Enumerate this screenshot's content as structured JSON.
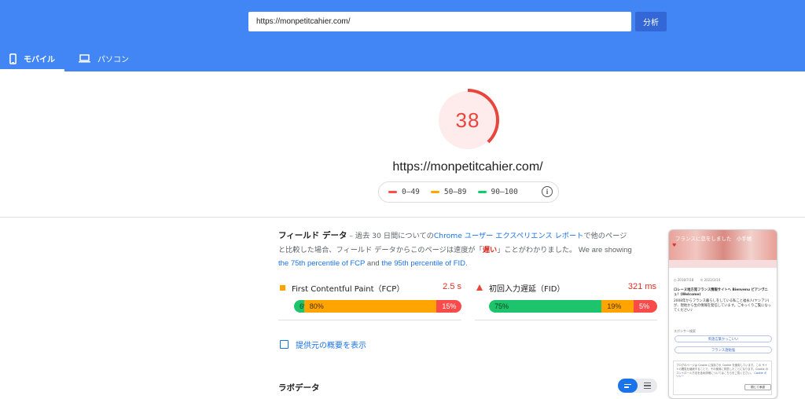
{
  "header": {
    "url_value": "https://monpetitcahier.com/",
    "analyze_label": "分析",
    "tabs": [
      {
        "label": "モバイル",
        "active": true
      },
      {
        "label": "パソコン",
        "active": false
      }
    ]
  },
  "score": {
    "value": "38",
    "fraction": 0.38,
    "color": "#e8453c",
    "url": "https://monpetitcahier.com/"
  },
  "legend": [
    {
      "label": "0–49",
      "color": "#ff4e42"
    },
    {
      "label": "50–89",
      "color": "#ffa400"
    },
    {
      "label": "90–100",
      "color": "#0cce6b"
    }
  ],
  "field_data": {
    "title": "フィールド データ",
    "desc_1": " – 過去 30 日間についての",
    "link_1": "Chrome ユーザー エクスペリエンス レポート",
    "desc_2": "で他のページと比較した場合、フィールド データからこのページは速度が「",
    "slow_word": "遅い",
    "desc_3": "」ことがわかりました。",
    "en_1": " We are showing ",
    "link_2": "the 75th percentile of FCP",
    "en_2": " and ",
    "link_3": "the 95th percentile of FID",
    "en_3": "."
  },
  "metrics": [
    {
      "name": "First Contentful Paint（FCP）",
      "value": "2.5 s",
      "distribution": [
        {
          "label": "6%",
          "fraction": 0.06,
          "kind": "g"
        },
        {
          "label": "80%",
          "fraction": 0.8,
          "kind": "o"
        },
        {
          "label": "15%",
          "fraction": 0.15,
          "kind": "r"
        }
      ]
    },
    {
      "name": "初回入力遅延（FID）",
      "value": "321 ms",
      "distribution": [
        {
          "label": "75%",
          "fraction": 0.67,
          "kind": "g"
        },
        {
          "label": "19%",
          "fraction": 0.19,
          "kind": "o"
        },
        {
          "label": "5%",
          "fraction": 0.14,
          "kind": "r"
        }
      ]
    }
  ],
  "origin_summary_label": "提供元の概要を表示",
  "lab_data_title": "ラボデータ",
  "phone": {
    "banner_title": "フランスに恋をしました　小手帳",
    "date_1": "2018/7/18",
    "date_2": "2022/3/14",
    "headline": "ロレーヌ地方発フランス情報サイトへ Bienvenu ビアンヴニュ！(Welcome)",
    "body": "2008年からフランス暮らしをしている私こと福永人(ヤンアジ)が、現地から生の情報を発信しています。ごゆっくりご覧になってください♪",
    "sponsor": "スポンサー検索",
    "btn_1": "英語言葉かっこいい",
    "btn_2": "フランス語勉強",
    "cookie_text": "ブログのページは Cookie に保存され Cookie を使用しています。この サイトの閲覧を継続することで、その使用に同意したことになります。Cookie のコントロール方法を含め詳細についてはこちらをご覧ください。",
    "cookie_link": "Cookie ポリシー",
    "close_btn": "閉じて承認"
  }
}
